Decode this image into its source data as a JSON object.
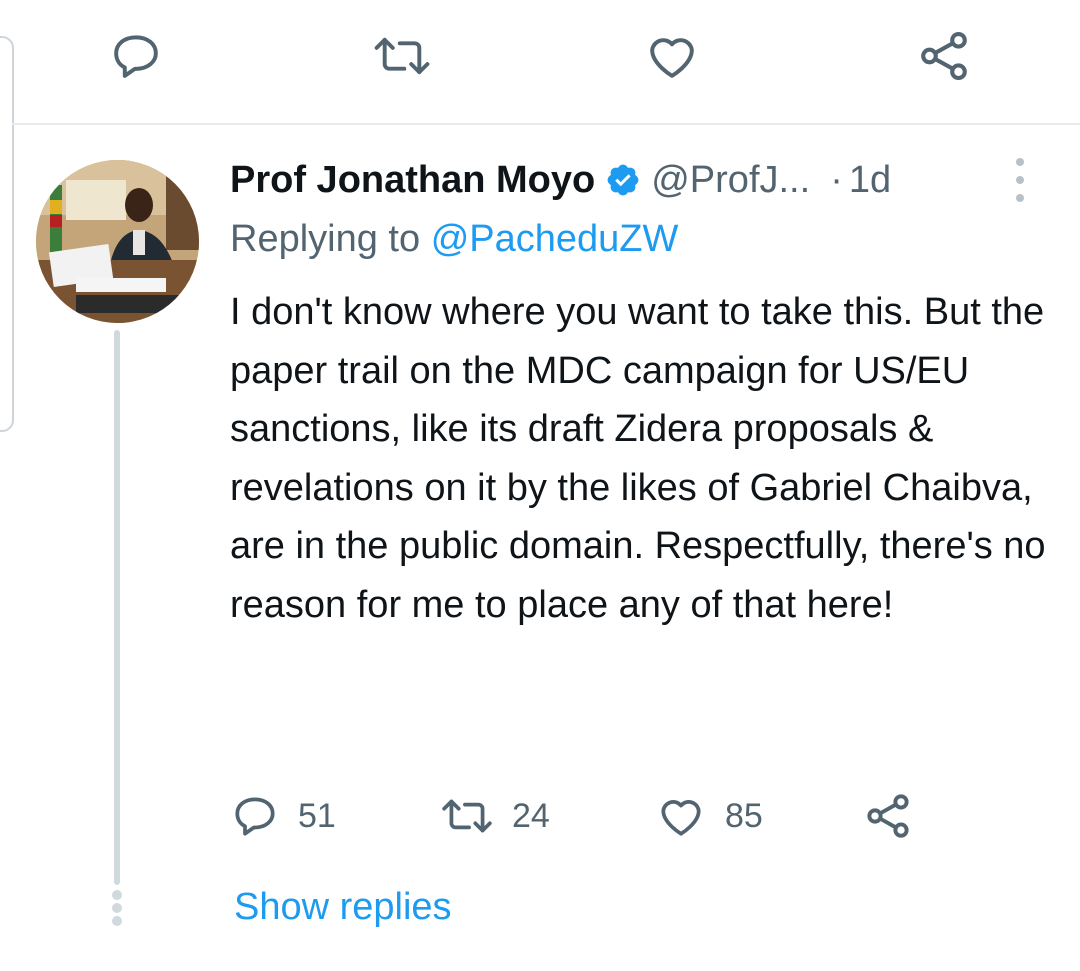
{
  "top_actions": {
    "reply_icon": "reply-icon",
    "retweet_icon": "retweet-icon",
    "like_icon": "heart-icon",
    "share_icon": "share-icon"
  },
  "tweet": {
    "author_name": "Prof Jonathan Moyo",
    "handle": "@ProfJ...",
    "separator": "·",
    "time": "1d",
    "verified": true,
    "replying_prefix": "Replying to",
    "replying_to": "@PacheduZW",
    "text": "I don't know where you want to take this. But the paper trail on the MDC campaign for US/EU sanctions, like its draft Zidera proposals & revelations on it by the likes of Gabriel Chaibva, are in the public domain. Respectfully, there's no reason for me to place any of that here!",
    "replies": "51",
    "retweets": "24",
    "likes": "85",
    "show_replies": "Show replies"
  },
  "colors": {
    "accent": "#1d9bf0",
    "secondary_text": "#536471",
    "icon": "#536471",
    "thread_line": "#cfd9de"
  }
}
